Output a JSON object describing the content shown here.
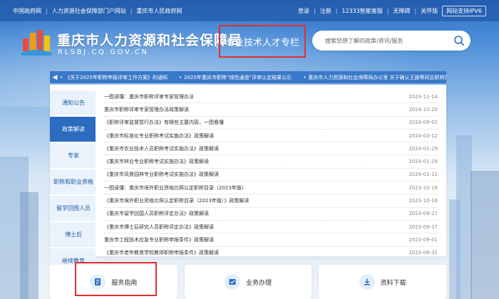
{
  "topbar": {
    "links_left": [
      "中国政府网",
      "人力资源社会保障部门户网站",
      "重庆市人民政府网"
    ],
    "links_right": [
      "登录",
      "注册",
      "12333智能客服",
      "无障碍",
      "关怀版"
    ],
    "ipv6_label": "网站支持IPV6"
  },
  "header": {
    "site_name": "重庆市人力资源和社会保障局",
    "site_domain": "RLSBJ.CQ.GOV.CN",
    "sub_column": "专业技术人才专栏",
    "search_placeholder": "搜索您想了解的政策/资讯/服务"
  },
  "ticker": {
    "items": [
      "《关于2025年职称申报评审工作方案》的通知",
      "2025年重庆市职称“绿色通道”评审认定结果公示",
      "重庆市人力资源和社会保障局办公室 关于确认王旗等同志职称的通知"
    ]
  },
  "tabs": [
    {
      "label": "通知公告"
    },
    {
      "label": "政策解读"
    },
    {
      "label": "专家"
    },
    {
      "label": "职称和职业资格"
    },
    {
      "label": "留学回国人员"
    },
    {
      "label": "博士后"
    },
    {
      "label": "继续教育"
    }
  ],
  "active_tab": 1,
  "list": [
    {
      "title": "一图读懂：重庆市职称评审专家管理办法",
      "date": "2024-11-14"
    },
    {
      "title": "重庆市职称评审专家管理办法政策解读",
      "date": "2024-10-20"
    },
    {
      "title": "《职称评审监督暂行办法》有哪些主要内容，一图看懂",
      "date": "2024-09-02"
    },
    {
      "title": "《重庆市标准化专业职称考试实施办法》政策解读",
      "date": "2024-03-12"
    },
    {
      "title": "《重庆市农业技术人员职称考试实施办法》政策解读",
      "date": "2024-01-29"
    },
    {
      "title": "《重庆市林业专业职称考试实施办法》政策解读",
      "date": "2024-01-29"
    },
    {
      "title": "《重庆市风景园林专业职称考试实施办法》政策解读",
      "date": "2024-01-11"
    },
    {
      "title": "一图读懂：重庆市境外职业资格比照认定职称目录（2023年版）",
      "date": "2023-10-16"
    },
    {
      "title": "《重庆市境外职业资格比照认定职称目录（2023年版）》政策解读",
      "date": "2023-10-16"
    },
    {
      "title": "《重庆市留学回国人员职称评定办法》政策解读",
      "date": "2023-09-27"
    },
    {
      "title": "《重庆市博士后研究人员职称评定办法》政策解读",
      "date": "2023-09-27"
    },
    {
      "title": "重庆市工程技术应急专业职称申报条件》政策解读",
      "date": "2023-09-01"
    },
    {
      "title": "《重庆市老年教育学校教师职称申报条件》政策解读",
      "date": "2023-08-31"
    }
  ],
  "cards": [
    {
      "label": "服务指南",
      "icon": "guide-icon"
    },
    {
      "label": "业务办理",
      "icon": "handle-icon"
    },
    {
      "label": "资料下载",
      "icon": "download-icon"
    }
  ],
  "colors": {
    "primary": "#2b6cc0",
    "highlight": "#e03030",
    "ticker": "#3a79c9"
  }
}
